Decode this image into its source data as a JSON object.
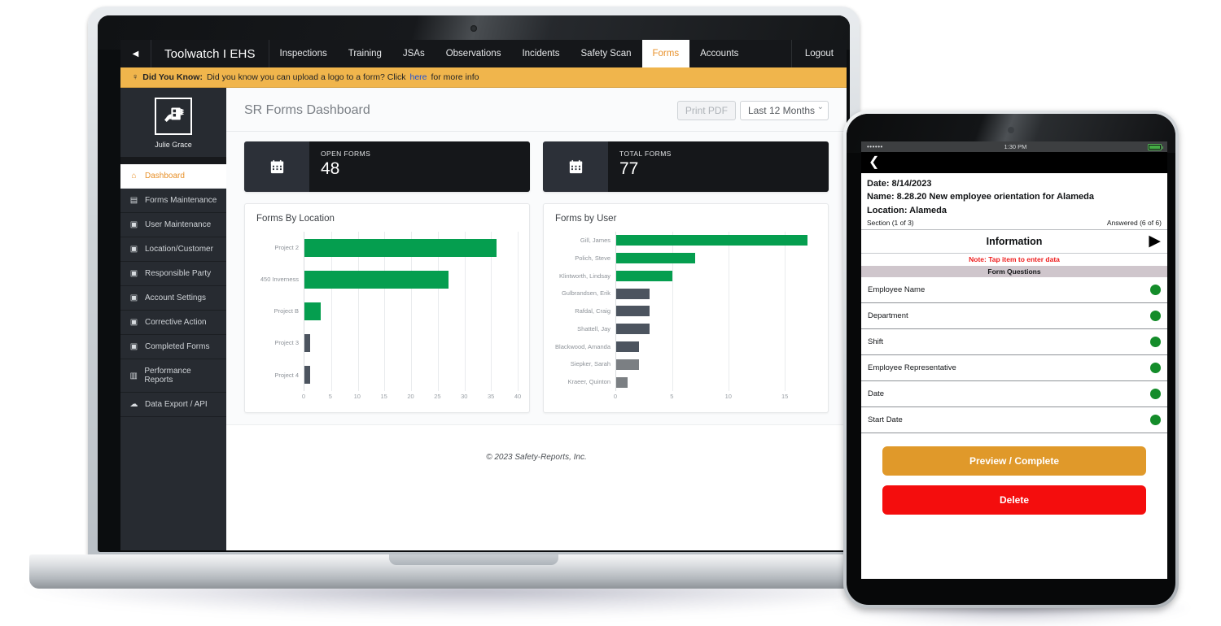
{
  "app": {
    "collapse_icon": "◀",
    "brand": "Toolwatch I EHS",
    "nav_items": [
      {
        "label": "Inspections",
        "active": false
      },
      {
        "label": "Training",
        "active": false
      },
      {
        "label": "JSAs",
        "active": false
      },
      {
        "label": "Observations",
        "active": false
      },
      {
        "label": "Incidents",
        "active": false
      },
      {
        "label": "Safety Scan",
        "active": false
      },
      {
        "label": "Forms",
        "active": true
      },
      {
        "label": "Accounts",
        "active": false
      }
    ],
    "logout": "Logout"
  },
  "banner": {
    "bulb_icon": "lightbulb-icon",
    "bulb_glyph": "♀",
    "title": "Did You Know:",
    "text_before": "Did you know you can upload a logo to a form? Click",
    "link": "here",
    "text_after": "for more info"
  },
  "sidebar": {
    "logo_icon": "clipboard-hand-icon",
    "user_name": "Julie Grace",
    "items": [
      {
        "label": "Dashboard",
        "icon": "home-icon",
        "glyph": "⌂",
        "active": true
      },
      {
        "label": "Forms Maintenance",
        "icon": "clipboard-icon",
        "glyph": "▤",
        "active": false
      },
      {
        "label": "User Maintenance",
        "icon": "user-gear-icon",
        "glyph": "▣",
        "active": false
      },
      {
        "label": "Location/Customer",
        "icon": "user-gear-icon",
        "glyph": "▣",
        "active": false
      },
      {
        "label": "Responsible Party",
        "icon": "user-gear-icon",
        "glyph": "▣",
        "active": false
      },
      {
        "label": "Account Settings",
        "icon": "user-gear-icon",
        "glyph": "▣",
        "active": false
      },
      {
        "label": "Corrective Action",
        "icon": "user-gear-icon",
        "glyph": "▣",
        "active": false
      },
      {
        "label": "Completed Forms",
        "icon": "user-gear-icon",
        "glyph": "▣",
        "active": false
      },
      {
        "label": "Performance Reports",
        "icon": "bar-chart-icon",
        "glyph": "▥",
        "active": false
      },
      {
        "label": "Data Export / API",
        "icon": "cloud-icon",
        "glyph": "☁",
        "active": false
      }
    ]
  },
  "page": {
    "title": "SR Forms Dashboard",
    "print_pdf": "Print PDF",
    "date_range": "Last 12 Months"
  },
  "stats": [
    {
      "icon": "calendar-icon",
      "label": "OPEN FORMS",
      "value": "48"
    },
    {
      "icon": "calendar-icon",
      "label": "TOTAL FORMS",
      "value": "77"
    }
  ],
  "chart_data": [
    {
      "type": "bar",
      "orientation": "horizontal",
      "title": "Forms By Location",
      "categories": [
        "Project 2",
        "450 Inverness",
        "Project B",
        "Project 3",
        "Project 4"
      ],
      "values": [
        36,
        27,
        3,
        1,
        1
      ],
      "colors": [
        "#059e4f",
        "#059e4f",
        "#059e4f",
        "#4c545f",
        "#4c545f"
      ],
      "xlabel": "",
      "ylabel": "",
      "xlim": [
        0,
        40
      ],
      "xticks": [
        0,
        5,
        10,
        15,
        20,
        25,
        30,
        35,
        40
      ],
      "grid": true,
      "legend": "none"
    },
    {
      "type": "bar",
      "orientation": "horizontal",
      "title": "Forms by User",
      "categories": [
        "Gill, James",
        "Polich, Steve",
        "Klintworth, Lindsay",
        "Gulbrandsen, Erik",
        "Rafdal, Craig",
        "Shattell, Jay",
        "Blackwood, Amanda",
        "Siepker, Sarah",
        "Kraeer, Quinton"
      ],
      "values": [
        17,
        7,
        5,
        3,
        3,
        3,
        2,
        2,
        1
      ],
      "colors": [
        "#059e4f",
        "#059e4f",
        "#059e4f",
        "#4c545f",
        "#4c545f",
        "#4c545f",
        "#4c545f",
        "#7b7f83",
        "#7b7f83"
      ],
      "xlabel": "",
      "ylabel": "",
      "xlim": [
        0,
        17.8
      ],
      "xticks": [
        0,
        5,
        10,
        15
      ],
      "grid": true,
      "legend": "none"
    }
  ],
  "footer": {
    "copyright": "© 2023 Safety-Reports, Inc."
  },
  "tablet": {
    "status": {
      "signal": "••••••",
      "time": "1:30 PM",
      "battery_icon": "battery-full-icon"
    },
    "back_icon": "chevron-left-icon",
    "back_glyph": "❮",
    "meta": {
      "date": "Date: 8/14/2023",
      "name": "Name: 8.28.20 New employee orientation  for Alameda",
      "location": "Location: Alameda"
    },
    "section_label": "Section (1 of 3)",
    "answered_label": "Answered (6 of 6)",
    "info_title": "Information",
    "info_arrow_icon": "play-arrow-icon",
    "info_arrow_glyph": "▶",
    "note": "Note: Tap item to enter data",
    "questions_header": "Form Questions",
    "questions": [
      {
        "label": "Employee Name",
        "status": "answered"
      },
      {
        "label": "Department",
        "status": "answered"
      },
      {
        "label": "Shift",
        "status": "answered"
      },
      {
        "label": "Employee Representative",
        "status": "answered"
      },
      {
        "label": "Date",
        "status": "answered"
      },
      {
        "label": "Start Date",
        "status": "answered"
      }
    ],
    "preview_button": "Preview / Complete",
    "delete_button": "Delete"
  },
  "colors": {
    "accent_orange": "#e8912a",
    "green": "#059e4f",
    "dark_gray": "#4c545f",
    "banner_yellow": "#f0b54c",
    "link_blue": "#1b4fd8",
    "delete_red": "#f40d0d",
    "preview_orange": "#e0992a"
  }
}
